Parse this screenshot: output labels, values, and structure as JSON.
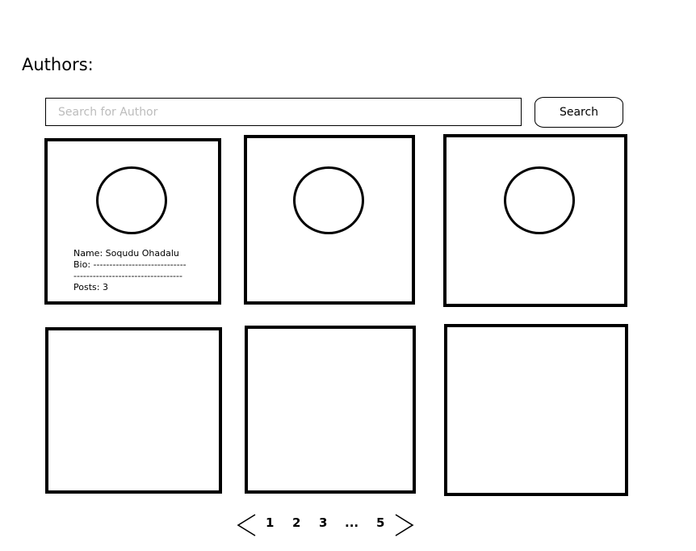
{
  "page": {
    "title": "Authors:"
  },
  "search": {
    "placeholder": "Search for Author",
    "value": "",
    "button_label": "Search"
  },
  "cards": [
    {
      "name_line": "Name: Soqudu Ohadalu",
      "bio_line1": "Bio: -----------------------------",
      "bio_line2": "----------------------------------",
      "posts_line": "Posts: 3"
    }
  ],
  "pagination": {
    "pages": [
      "1",
      "2",
      "3",
      "...",
      "5"
    ],
    "prev_icon": "chevron-left-icon",
    "next_icon": "chevron-right-icon"
  }
}
